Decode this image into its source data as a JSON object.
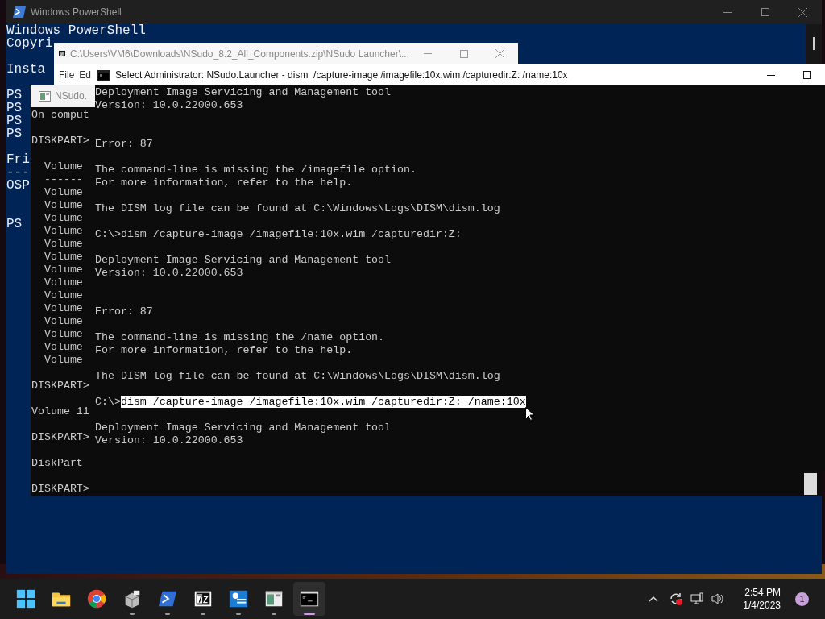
{
  "powershell": {
    "title": "Windows PowerShell",
    "lines": [
      {
        "kind": "text",
        "text": "Windows PowerShell"
      },
      {
        "kind": "text",
        "text": "Copyri"
      },
      {
        "kind": "blank"
      },
      {
        "kind": "text",
        "text": "Insta"
      },
      {
        "kind": "blank"
      },
      {
        "kind": "text",
        "text": "PS"
      },
      {
        "kind": "text",
        "text": "PS"
      },
      {
        "kind": "text",
        "text": "PS"
      },
      {
        "kind": "text",
        "text": "PS"
      },
      {
        "kind": "blank"
      },
      {
        "kind": "text",
        "text": "Fri"
      },
      {
        "kind": "text",
        "text": "---"
      },
      {
        "kind": "text",
        "text": "OSP"
      },
      {
        "kind": "blank"
      },
      {
        "kind": "blank"
      },
      {
        "kind": "text",
        "text": "PS"
      }
    ]
  },
  "sevenzip": {
    "title": "C:\\Users\\VM6\\Downloads\\NSudo_8.2_All_Components.zip\\NSudo Launcher\\...",
    "menu": [
      "File",
      "Ed"
    ]
  },
  "nsudo": {
    "title": "NSudo.",
    "lines": [
      {
        "kind": "text",
        "text": "On comput"
      },
      {
        "kind": "blank"
      },
      {
        "kind": "text",
        "text": "DISKPART>"
      },
      {
        "kind": "blank"
      },
      {
        "kind": "text",
        "text": "  Volume"
      },
      {
        "kind": "text",
        "text": "  ------"
      },
      {
        "kind": "text",
        "text": "  Volume"
      },
      {
        "kind": "text",
        "text": "  Volume"
      },
      {
        "kind": "text",
        "text": "  Volume"
      },
      {
        "kind": "text",
        "text": "  Volume"
      },
      {
        "kind": "text",
        "text": "  Volume"
      },
      {
        "kind": "text",
        "text": "  Volume"
      },
      {
        "kind": "text",
        "text": "  Volume"
      },
      {
        "kind": "text",
        "text": "  Volume"
      },
      {
        "kind": "text",
        "text": "  Volume"
      },
      {
        "kind": "text",
        "text": "  Volume"
      },
      {
        "kind": "text",
        "text": "  Volume"
      },
      {
        "kind": "text",
        "text": "  Volume"
      },
      {
        "kind": "text",
        "text": "  Volume"
      },
      {
        "kind": "text",
        "text": "  Volume"
      },
      {
        "kind": "blank"
      },
      {
        "kind": "text",
        "text": "DISKPART>"
      },
      {
        "kind": "blank"
      },
      {
        "kind": "text",
        "text": "Volume 11"
      },
      {
        "kind": "blank"
      },
      {
        "kind": "text",
        "text": "DISKPART>"
      },
      {
        "kind": "blank"
      },
      {
        "kind": "text",
        "text": "DiskPart"
      },
      {
        "kind": "blank"
      },
      {
        "kind": "text",
        "text": "DISKPART>"
      }
    ]
  },
  "dism": {
    "title": "Select Administrator: NSudo.Launcher - dism  /capture-image /imagefile:10x.wim /capturedir:Z: /name:10x",
    "lines": [
      {
        "kind": "text",
        "text": "Deployment Image Servicing and Management tool"
      },
      {
        "kind": "text",
        "text": "Version: 10.0.22000.653"
      },
      {
        "kind": "blank"
      },
      {
        "kind": "blank"
      },
      {
        "kind": "text",
        "text": "Error: 87"
      },
      {
        "kind": "blank"
      },
      {
        "kind": "text",
        "text": "The command-line is missing the /imagefile option."
      },
      {
        "kind": "text",
        "text": "For more information, refer to the help."
      },
      {
        "kind": "blank"
      },
      {
        "kind": "text",
        "text": "The DISM log file can be found at C:\\Windows\\Logs\\DISM\\dism.log"
      },
      {
        "kind": "blank"
      },
      {
        "kind": "text",
        "text": "C:\\>dism /capture-image /imagefile:10x.wim /capturedir:Z:"
      },
      {
        "kind": "blank"
      },
      {
        "kind": "text",
        "text": "Deployment Image Servicing and Management tool"
      },
      {
        "kind": "text",
        "text": "Version: 10.0.22000.653"
      },
      {
        "kind": "blank"
      },
      {
        "kind": "blank"
      },
      {
        "kind": "text",
        "text": "Error: 87"
      },
      {
        "kind": "blank"
      },
      {
        "kind": "text",
        "text": "The command-line is missing the /name option."
      },
      {
        "kind": "text",
        "text": "For more information, refer to the help."
      },
      {
        "kind": "blank"
      },
      {
        "kind": "text",
        "text": "The DISM log file can be found at C:\\Windows\\Logs\\DISM\\dism.log"
      },
      {
        "kind": "blank"
      },
      {
        "kind": "selection",
        "text": "C:\\>",
        "selection": "dism /capture-image /imagefile:10x.wim /capturedir:Z: /name:10x"
      },
      {
        "kind": "blank"
      },
      {
        "kind": "text",
        "text": "Deployment Image Servicing and Management tool"
      },
      {
        "kind": "text",
        "text": "Version: 10.0.22000.653"
      }
    ]
  },
  "taskbar": {
    "apps": [
      {
        "kind": "start",
        "running": false,
        "selected": false
      },
      {
        "kind": "folder",
        "running": false,
        "selected": false
      },
      {
        "kind": "chrome",
        "running": false,
        "selected": false
      },
      {
        "kind": "box",
        "running": true,
        "selected": false
      },
      {
        "kind": "powershell",
        "running": true,
        "selected": false
      },
      {
        "kind": "sevenzip",
        "running": true,
        "selected": false
      },
      {
        "kind": "settings",
        "running": true,
        "selected": false
      },
      {
        "kind": "window",
        "running": true,
        "selected": false
      },
      {
        "kind": "console",
        "running": true,
        "selected": true
      }
    ],
    "time": "2:54 PM",
    "date": "1/4/2023",
    "notifications": "1"
  }
}
